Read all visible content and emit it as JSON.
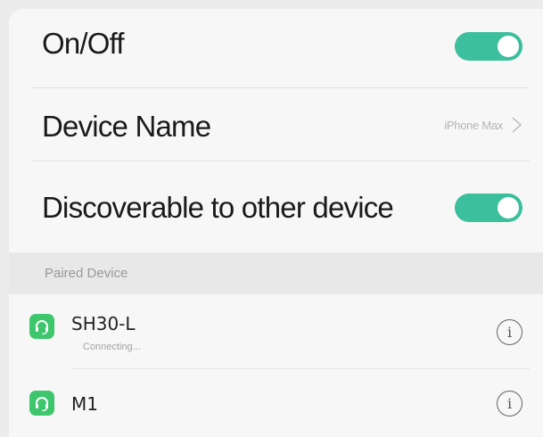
{
  "settings": {
    "power": {
      "label": "On/Off",
      "enabled": true
    },
    "device_name": {
      "label": "Device Name",
      "value": "iPhone Max"
    },
    "discoverable": {
      "label": "Discoverable to other device",
      "enabled": true
    }
  },
  "paired": {
    "header": "Paired Device",
    "devices": [
      {
        "name": "SH30-L",
        "status": "Connecting...",
        "icon": "headset-icon"
      },
      {
        "name": "M1",
        "icon": "headset-icon"
      }
    ]
  },
  "colors": {
    "toggle_on": "#3bbf9c",
    "device_icon": "#3ec66d"
  },
  "info_glyph": "i"
}
